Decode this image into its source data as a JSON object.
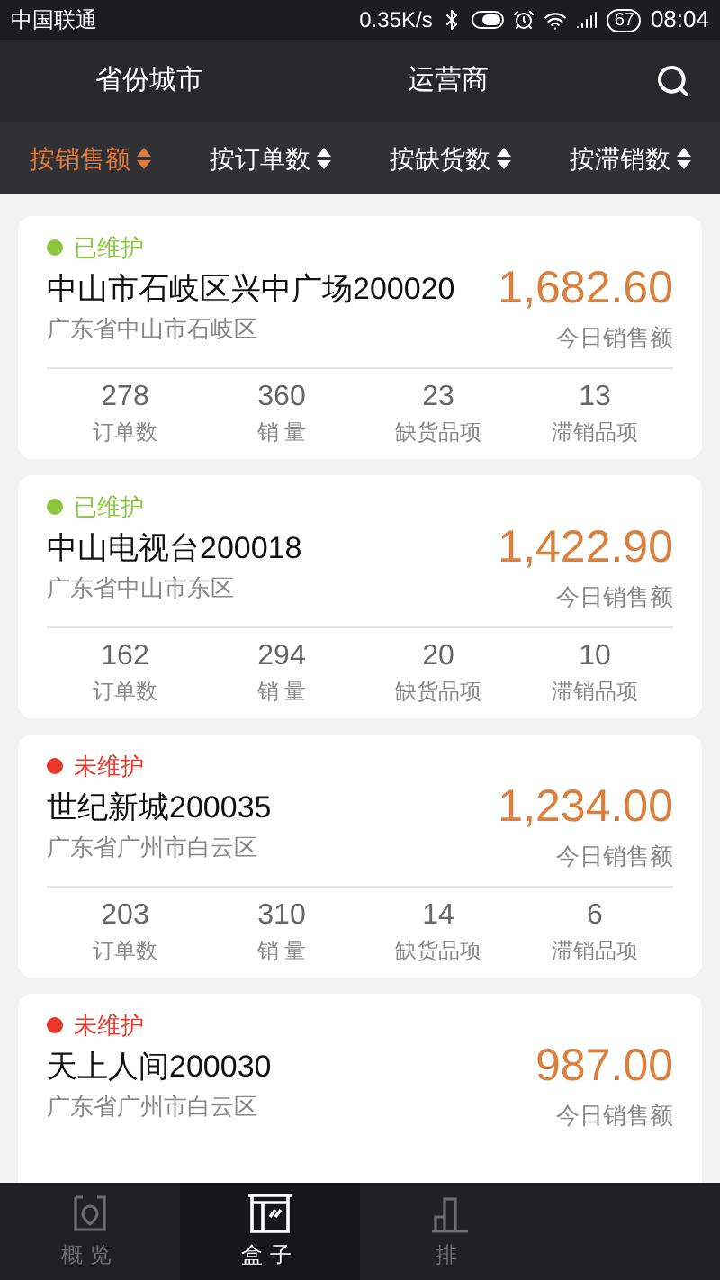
{
  "status_bar": {
    "carrier": "中国联通",
    "speed": "0.35K/s",
    "battery": "67",
    "time": "08:04"
  },
  "header": {
    "tabs": [
      {
        "label": "省份城市",
        "selected": false
      },
      {
        "label": "运营商",
        "selected": false
      }
    ]
  },
  "sort_bar": [
    {
      "label": "按销售额",
      "selected": true
    },
    {
      "label": "按订单数",
      "selected": false
    },
    {
      "label": "按缺货数",
      "selected": false
    },
    {
      "label": "按滞销数",
      "selected": false
    }
  ],
  "stores": [
    {
      "status": "已维护",
      "color": "#8cc63f",
      "name": "中山市石岐区兴中广场200020",
      "address": "广东省中山市石岐区",
      "amount": "1,682.60",
      "amount_label": "今日销售额",
      "stats": [
        {
          "value": "278",
          "label": "订单数"
        },
        {
          "value": "360",
          "label": "销 量"
        },
        {
          "value": "23",
          "label": "缺货品项"
        },
        {
          "value": "13",
          "label": "滞销品项"
        }
      ]
    },
    {
      "status": "已维护",
      "color": "#8cc63f",
      "name": "中山电视台200018",
      "address": "广东省中山市东区",
      "amount": "1,422.90",
      "amount_label": "今日销售额",
      "stats": [
        {
          "value": "162",
          "label": "订单数"
        },
        {
          "value": "294",
          "label": "销 量"
        },
        {
          "value": "20",
          "label": "缺货品项"
        },
        {
          "value": "10",
          "label": "滞销品项"
        }
      ]
    },
    {
      "status": "未维护",
      "color": "#e8382b",
      "name": "世纪新城200035",
      "address": "广东省广州市白云区",
      "amount": "1,234.00",
      "amount_label": "今日销售额",
      "stats": [
        {
          "value": "203",
          "label": "订单数"
        },
        {
          "value": "310",
          "label": "销 量"
        },
        {
          "value": "14",
          "label": "缺货品项"
        },
        {
          "value": "6",
          "label": "滞销品项"
        }
      ]
    },
    {
      "status": "未维护",
      "color": "#e8382b",
      "name": "天上人间200030",
      "address": "广东省广州市白云区",
      "amount": "987.00",
      "amount_label": "今日销售额"
    }
  ],
  "bottom_nav": [
    {
      "label": "概览",
      "kind": "overview",
      "selected": false
    },
    {
      "label": "盒子",
      "kind": "box",
      "selected": true
    },
    {
      "label": "排",
      "kind": "ranking",
      "selected": false
    }
  ]
}
